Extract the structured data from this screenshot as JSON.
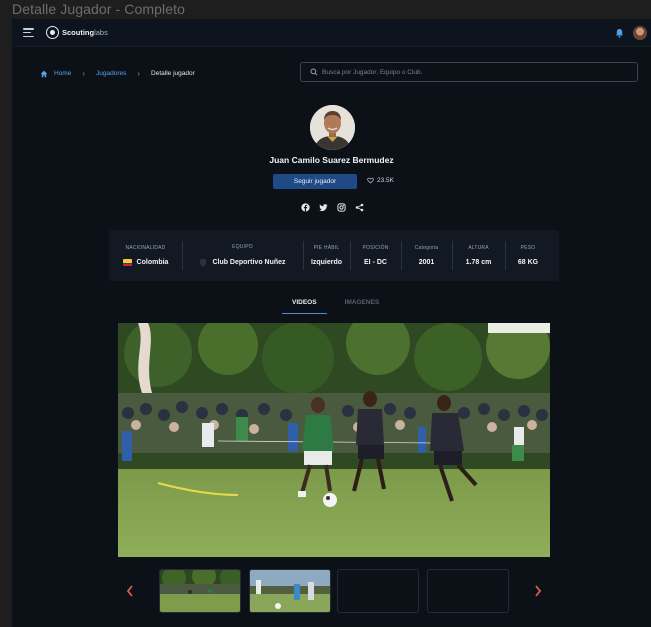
{
  "window": {
    "title": "Detalle Jugador - Completo"
  },
  "header": {
    "logo_bold": "Scouting",
    "logo_light": "labs",
    "icons": [
      "menu-icon",
      "bell-icon",
      "avatar"
    ]
  },
  "breadcrumb": {
    "home": "Home",
    "players": "Jugadores",
    "current": "Detalle jugador"
  },
  "search": {
    "placeholder": "Busca por Jugador, Equipo o Club."
  },
  "player": {
    "name": "Juan Camilo Suarez Bermudez",
    "follow_label": "Seguir jugador",
    "likes": "23.5K",
    "socials": [
      "facebook-icon",
      "twitter-icon",
      "instagram-icon",
      "share-icon"
    ]
  },
  "stats": [
    {
      "label": "NACIONALIDAD",
      "value": "Colombia"
    },
    {
      "label": "EQUIPO",
      "value": "Club Deportivo Nuñez"
    },
    {
      "label": "PIE HÁBIL",
      "value": "Izquierdo"
    },
    {
      "label": "POSICIÓN",
      "value": "EI - DC"
    },
    {
      "label": "Categoria",
      "value": "2001"
    },
    {
      "label": "ALTURA",
      "value": "1.78 cm"
    },
    {
      "label": "PESO",
      "value": "68 KG"
    }
  ],
  "tabs": {
    "videos": "VIDEOS",
    "images": "IMAGENES",
    "active": "VIDEOS"
  },
  "colors": {
    "accent": "#1f4a86",
    "link": "#5aa4e6",
    "background": "#0c1118",
    "tab_underline": "#4d8fd6"
  }
}
